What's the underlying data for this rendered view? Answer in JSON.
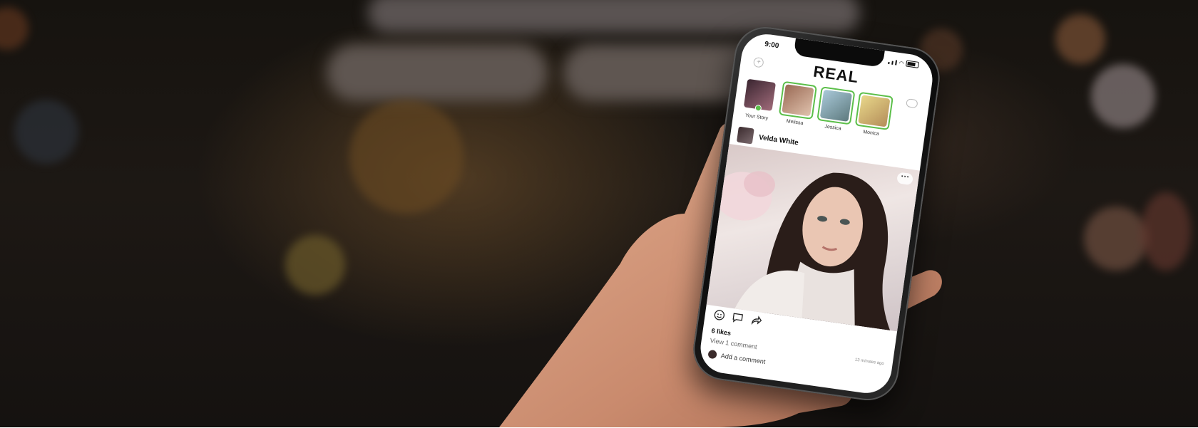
{
  "status_bar": {
    "time": "9:00"
  },
  "app": {
    "brand": "REAL"
  },
  "stories": [
    {
      "label": "Your Story",
      "own": true,
      "colors": [
        "#3a2530",
        "#a06b7a"
      ]
    },
    {
      "label": "Melissa",
      "colors": [
        "#9a6a55",
        "#e0c2ad"
      ]
    },
    {
      "label": "Jessica",
      "colors": [
        "#a9c9d9",
        "#5e7a7e"
      ]
    },
    {
      "label": "Monica",
      "colors": [
        "#e8d78a",
        "#b48d59"
      ]
    }
  ],
  "post": {
    "user": "Velda White",
    "likes": "6 likes",
    "view_comments": "View 1 comment",
    "time_ago": "13 minutes ago",
    "add_comment": "Add a comment"
  },
  "colors": {
    "story_ring": "#5cbf4a"
  }
}
